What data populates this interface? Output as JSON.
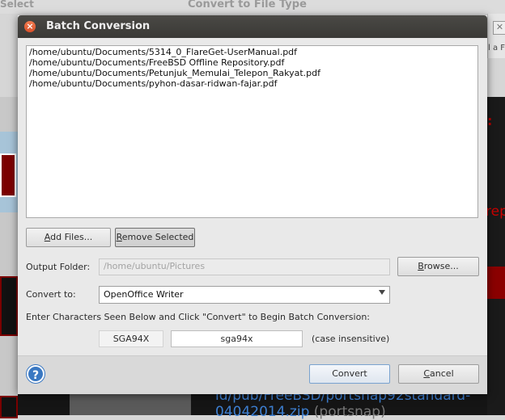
{
  "background": {
    "select_label": "Select",
    "convert_label": "Convert to File Type",
    "right_partial_text": "l a F",
    "link_line1": "ld/pub/FreeBSD/portsnap92standard-",
    "link_line2": "04042014.zip",
    "link_suffix": " (portsnap)"
  },
  "dialog": {
    "title": "Batch Conversion",
    "files": [
      "/home/ubuntu/Documents/5314_0_FlareGet-UserManual.pdf",
      "/home/ubuntu/Documents/FreeBSD Offline Repository.pdf",
      "/home/ubuntu/Documents/Petunjuk_Memulai_Telepon_Rakyat.pdf",
      "/home/ubuntu/Documents/pyhon-dasar-ridwan-fajar.pdf"
    ],
    "add_files_label": "Add Files...",
    "remove_selected_label": "Remove Selected",
    "output_folder_label": "Output Folder:",
    "output_folder_value": "/home/ubuntu/Pictures",
    "browse_label": "Browse...",
    "convert_to_label": "Convert to:",
    "convert_to_value": "OpenOffice Writer",
    "instructions": "Enter Characters Seen Below and Click \"Convert\" to Begin Batch Conversion:",
    "captcha_text": "SGA94X",
    "captcha_input_value": "sga94x",
    "case_note": "(case insensitive)",
    "help_glyph": "?",
    "convert_button": "Convert",
    "cancel_button": "Cancel"
  },
  "icons": {
    "close": "close-icon",
    "help": "help-icon",
    "dropdown": "chevron-down-icon"
  },
  "colors": {
    "titlebar": "#3f3e3b",
    "close_button": "#e0603a",
    "help_icon": "#3a78c2",
    "dialog_bg": "#e9e9e9"
  }
}
